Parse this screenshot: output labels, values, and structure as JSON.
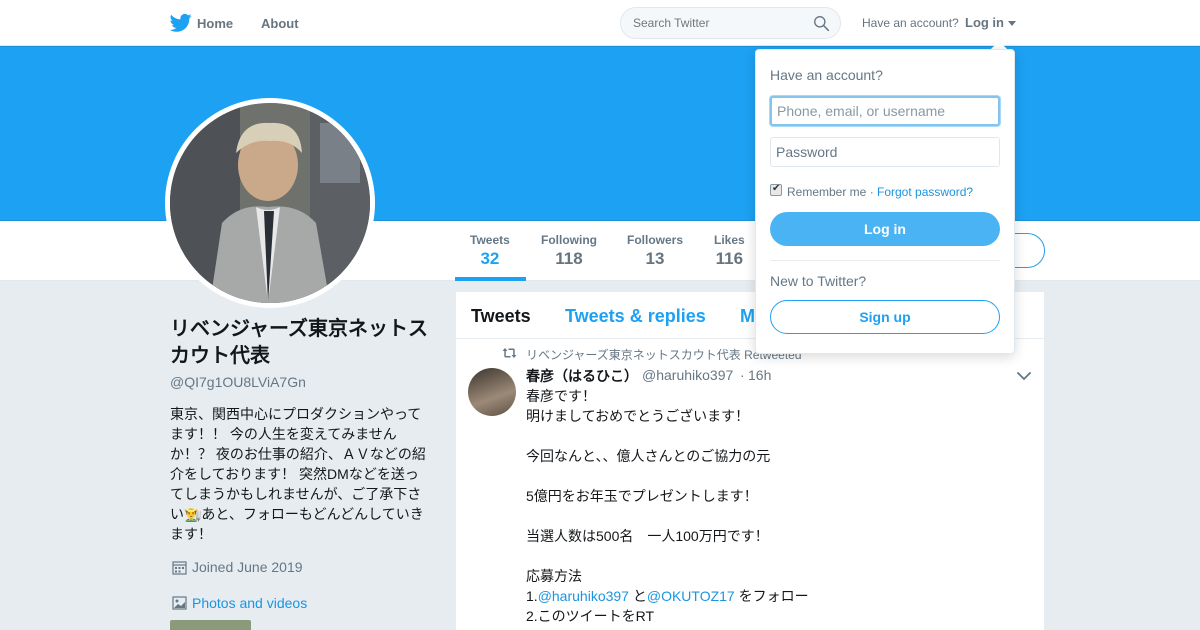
{
  "nav": {
    "home_label": "Home",
    "about_label": "About",
    "search_placeholder": "Search Twitter",
    "have_account": "Have an account?",
    "login_label": "Log in"
  },
  "profile_nav": {
    "stats": [
      {
        "label": "Tweets",
        "value": "32"
      },
      {
        "label": "Following",
        "value": "118"
      },
      {
        "label": "Followers",
        "value": "13"
      },
      {
        "label": "Likes",
        "value": "116"
      }
    ]
  },
  "profile": {
    "name": "リベンジャーズ東京ネットスカウト代表",
    "handle": "@QI7g1OU8LViA7Gn",
    "bio": "東京、関西中心にプロダクションやってます！！ 今の人生を変えてみませんか！？ 夜のお仕事の紹介、ＡＶなどの紹介をしております！ 突然DMなどを送ってしまうかもしれませんが、ご了承下さい👨‍🌾あと、フォローもどんどんしていきます！",
    "joined": "Joined June 2019",
    "photos_label": "Photos and videos"
  },
  "timeline": {
    "tabs": [
      "Tweets",
      "Tweets & replies",
      "M"
    ],
    "tweet": {
      "retweet_context": "リベンジャーズ東京ネットスカウト代表 Retweeted",
      "author_name": "春彦（はるひこ）",
      "author_handle": "@haruhiko397",
      "dot": "·",
      "time": "16h",
      "lines": [
        "春彦です！",
        "明けましておめでとうございます！",
        "",
        "今回なんと、、億人さんとのご協力の元",
        "",
        "5億円をお年玉でプレゼントします！",
        "",
        "当選人数は500名　一人100万円です！",
        "",
        "応募方法"
      ],
      "line11_prefix": "1.",
      "line11_mention1": "@haruhiko397",
      "line11_mid": " と",
      "line11_mention2": "@OKUTOZ17",
      "line11_suffix": " をフォロー",
      "line12": "2.このツイートをRT"
    }
  },
  "login_dropdown": {
    "heading": "Have an account?",
    "username_placeholder": "Phone, email, or username",
    "password_placeholder": "Password",
    "remember_label": "Remember me",
    "separator": "·",
    "forgot_label": "Forgot password?",
    "login_button": "Log in",
    "new_label": "New to Twitter?",
    "signup_button": "Sign up"
  },
  "colors": {
    "brand_blue": "#1da1f2",
    "link_blue": "#1b95e0",
    "page_bg": "#e6ecf0"
  }
}
